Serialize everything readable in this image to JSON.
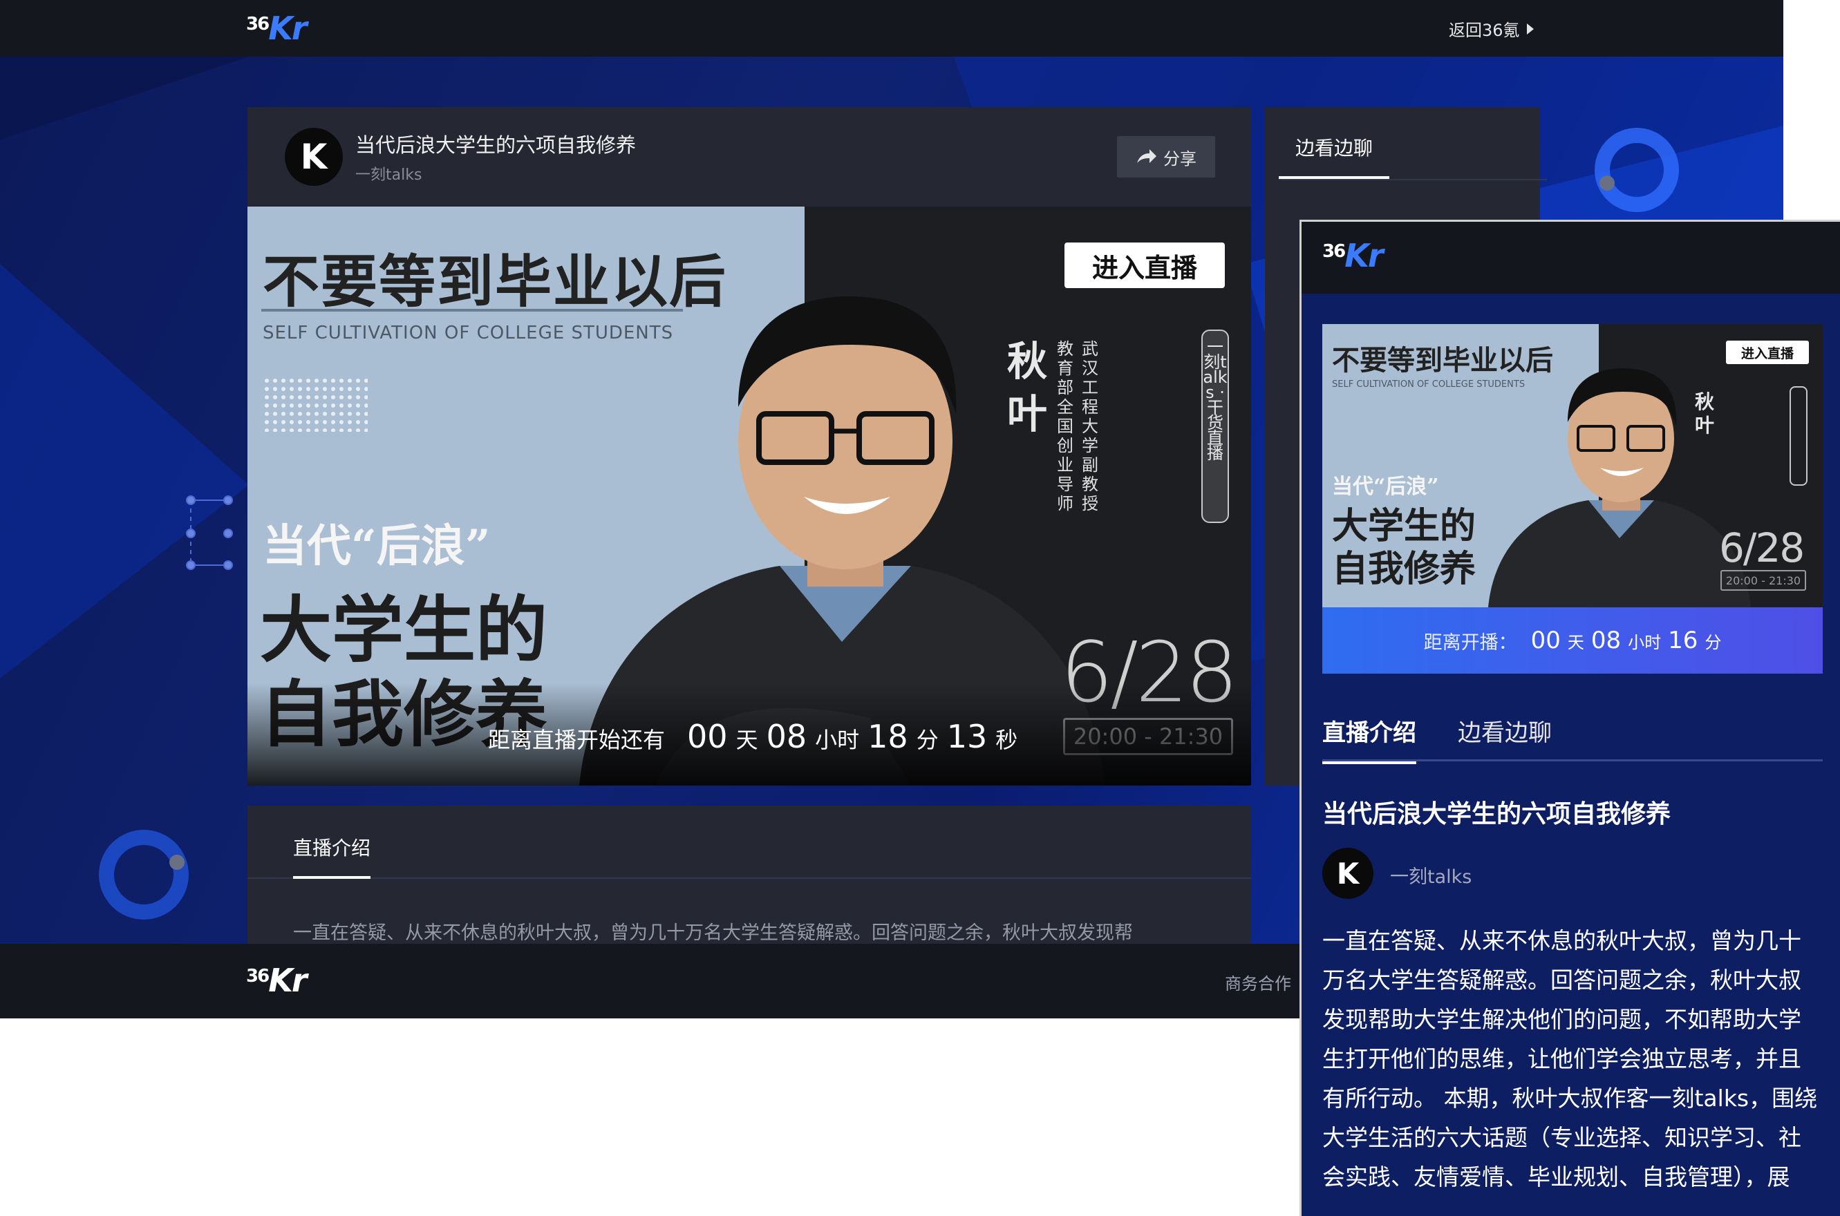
{
  "site": {
    "back_link": "返回36氪",
    "footer_link": "商务合作"
  },
  "live": {
    "title": "当代后浪大学生的六项自我修养",
    "author": "一刻talks",
    "share_label": "分享",
    "side_tab": "边看边聊",
    "intro_tab": "直播介绍",
    "intro_text_preview": "一直在答疑、从来不休息的秋叶大叔，曾为几十万名大学生答疑解惑。回答问题之余，秋叶大叔发现帮"
  },
  "poster": {
    "headline": "不要等到毕业以后",
    "subtitle_en": "SELF CULTIVATION OF COLLEGE STUDENTS",
    "quote_line": "当代“后浪”",
    "big_line_1": "大学生的",
    "big_line_2": "自我修养",
    "enter_button": "进入直播",
    "speaker_name_1": "秋",
    "speaker_name_2": "叶",
    "speaker_title_1": "武汉工程大学副教授",
    "speaker_title_2": "教育部全国创业导师",
    "series_tag": "一刻talks · 干货直播",
    "date": "6/28",
    "time_range": "20:00 - 21:30"
  },
  "countdown": {
    "label": "距离直播开始还有",
    "days": "00",
    "days_unit": "天",
    "hours": "08",
    "hours_unit": "小时",
    "minutes": "18",
    "minutes_unit": "分",
    "seconds": "13",
    "seconds_unit": "秒"
  },
  "mobile": {
    "countdown_label": "距离开播：",
    "days": "00",
    "days_unit": "天",
    "hours": "08",
    "hours_unit": "小时",
    "minutes": "16",
    "minutes_unit": "分",
    "tab_intro": "直播介绍",
    "tab_chat": "边看边聊",
    "title": "当代后浪大学生的六项自我修养",
    "author": "一刻talks",
    "intro_lines": [
      "一直在答疑、从来不休息的秋叶大叔，曾为几十",
      "万名大学生答疑解惑。回答问题之余，秋叶大叔",
      "发现帮助大学生解决他们的问题，不如帮助大学",
      "生打开他们的思维，让他们学会独立思考，并且",
      "有所行动。 本期，秋叶大叔作客一刻talks，围绕",
      "大学生活的六大话题（专业选择、知识学习、社",
      "会实践、友情爱情、毕业规划、自我管理），展"
    ]
  },
  "colors": {
    "accent_blue": "#3b7bff",
    "topbar": "#15171f",
    "panel": "#252733"
  }
}
